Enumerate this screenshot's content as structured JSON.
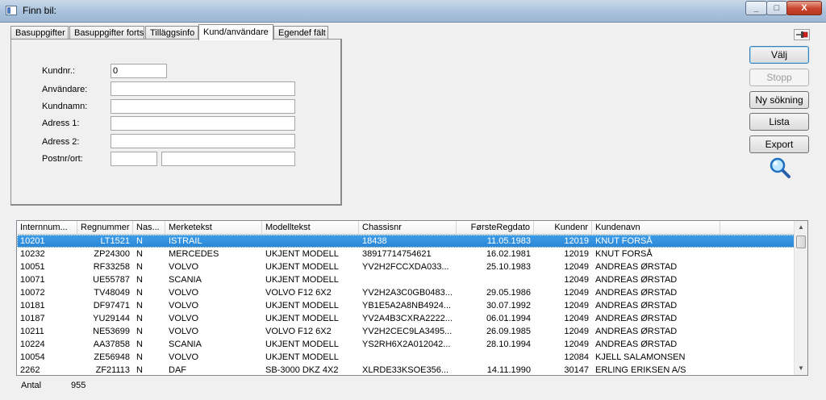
{
  "window": {
    "title": "Finn bil:",
    "minimize": "_",
    "maximize": "□",
    "close": "X"
  },
  "tabs": [
    {
      "label": "Basuppgifter",
      "active": false
    },
    {
      "label": "Basuppgifter forts",
      "active": false
    },
    {
      "label": "Tilläggsinfo",
      "active": false
    },
    {
      "label": "Kund/användare",
      "active": true
    },
    {
      "label": "Egendef fält",
      "active": false
    }
  ],
  "form": {
    "kundnr": {
      "label": "Kundnr.:",
      "value": "0"
    },
    "anvandare": {
      "label": "Användare:",
      "value": ""
    },
    "kundnamn": {
      "label": "Kundnamn:",
      "value": ""
    },
    "adress1": {
      "label": "Adress 1:",
      "value": ""
    },
    "adress2": {
      "label": "Adress 2:",
      "value": ""
    },
    "postnr_ort": {
      "label": "Postnr/ort:",
      "postnr": "",
      "ort": ""
    }
  },
  "buttons": {
    "valj": "Välj",
    "stopp": "Stopp",
    "ny_sokning": "Ny sökning",
    "lista": "Lista",
    "export": "Export"
  },
  "table": {
    "columns": [
      "Internnum...",
      "Regnummer",
      "Nas...",
      "Merketekst",
      "Modelltekst",
      "Chassisnr",
      "FørsteRegdato",
      "Kundenr",
      "Kundenavn"
    ],
    "rows": [
      [
        "10201",
        "LT1521",
        "N",
        "ISTRAIL",
        "",
        "18438",
        "11.05.1983",
        "12019",
        "KNUT FORSÅ"
      ],
      [
        "10232",
        "ZP24300",
        "N",
        "MERCEDES",
        "UKJENT MODELL",
        "38917714754621",
        "16.02.1981",
        "12019",
        "KNUT FORSÅ"
      ],
      [
        "10051",
        "RF33258",
        "N",
        "VOLVO",
        "UKJENT MODELL",
        "YV2H2FCCXDA033...",
        "25.10.1983",
        "12049",
        "ANDREAS ØRSTAD"
      ],
      [
        "10071",
        "UE55787",
        "N",
        "SCANIA",
        "UKJENT MODELL",
        "",
        "",
        "12049",
        "ANDREAS ØRSTAD"
      ],
      [
        "10072",
        "TV48049",
        "N",
        "VOLVO",
        "VOLVO F12 6X2",
        "YV2H2A3C0GB0483...",
        "29.05.1986",
        "12049",
        "ANDREAS ØRSTAD"
      ],
      [
        "10181",
        "DF97471",
        "N",
        "VOLVO",
        "UKJENT MODELL",
        "YB1E5A2A8NB4924...",
        "30.07.1992",
        "12049",
        "ANDREAS ØRSTAD"
      ],
      [
        "10187",
        "YU29144",
        "N",
        "VOLVO",
        "UKJENT MODELL",
        "YV2A4B3CXRA2222...",
        "06.01.1994",
        "12049",
        "ANDREAS ØRSTAD"
      ],
      [
        "10211",
        "NE53699",
        "N",
        "VOLVO",
        "VOLVO F12 6X2",
        "YV2H2CEC9LA3495...",
        "26.09.1985",
        "12049",
        "ANDREAS ØRSTAD"
      ],
      [
        "10224",
        "AA37858",
        "N",
        "SCANIA",
        "UKJENT MODELL",
        "YS2RH6X2A012042...",
        "28.10.1994",
        "12049",
        "ANDREAS ØRSTAD"
      ],
      [
        "10054",
        "ZE56948",
        "N",
        "VOLVO",
        "UKJENT MODELL",
        "",
        "",
        "12084",
        "KJELL SALAMONSEN"
      ],
      [
        "2262",
        "ZF21113",
        "N",
        "DAF",
        "SB-3000 DKZ 4X2",
        "XLRDE33KSOE356...",
        "14.11.1990",
        "30147",
        "ERLING ERIKSEN A/S"
      ]
    ]
  },
  "status": {
    "label": "Antal",
    "value": "955"
  }
}
